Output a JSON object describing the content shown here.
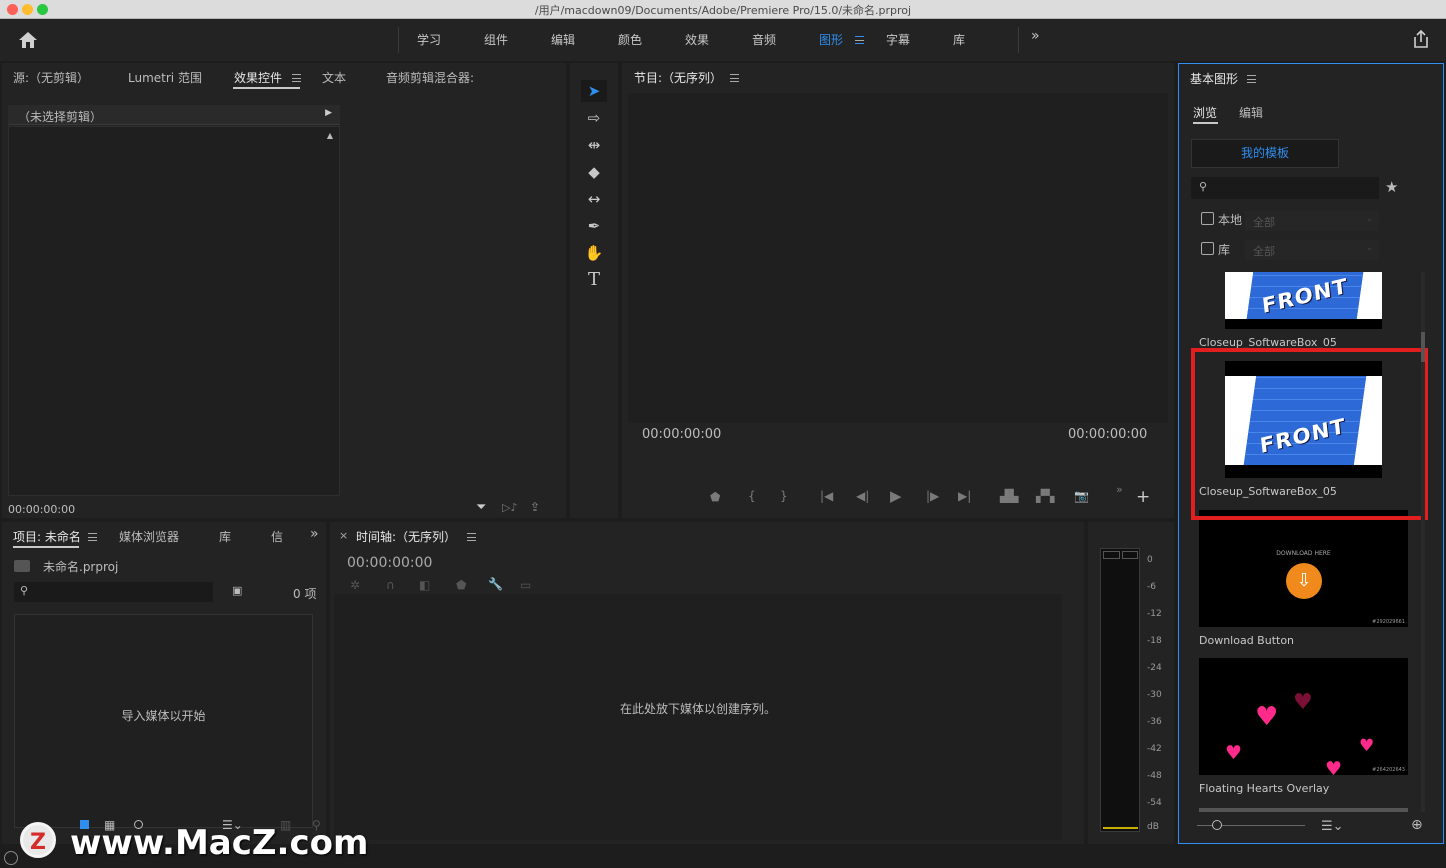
{
  "window": {
    "title": "/用户/macdown09/Documents/Adobe/Premiere Pro/15.0/未命名.prproj",
    "traffic_colors": [
      "#fe5f57",
      "#febc2e",
      "#28c840"
    ]
  },
  "workspaces": {
    "items": [
      "学习",
      "组件",
      "编辑",
      "颜色",
      "效果",
      "音频",
      "图形",
      "字幕",
      "库"
    ],
    "active": "图形",
    "accent": "#2f8ef0",
    "more": "»"
  },
  "source_panel": {
    "tabs": [
      "源:（无剪辑）",
      "Lumetri 范围",
      "效果控件",
      "文本",
      "音频剪辑混合器:"
    ],
    "active": "效果控件",
    "no_clip": "（未选择剪辑）",
    "timecode": "00:00:00:00"
  },
  "program_panel": {
    "title": "节目:（无序列）",
    "timecode_left": "00:00:00:00",
    "timecode_right": "00:00:00:00"
  },
  "project_panel": {
    "tabs": [
      "项目: 未命名",
      "媒体浏览器",
      "库",
      "信"
    ],
    "file": "未命名.prproj",
    "count": "0 项",
    "empty_text": "导入媒体以开始"
  },
  "timeline_panel": {
    "close": "×",
    "title": "时间轴:（无序列）",
    "timecode": "00:00:00:00",
    "empty_text": "在此处放下媒体以创建序列。"
  },
  "meter": {
    "scale": [
      "0",
      "-6",
      "-12",
      "-18",
      "-24",
      "-30",
      "-36",
      "-42",
      "-48",
      "-54",
      "dB"
    ]
  },
  "essential_graphics": {
    "title": "基本图形",
    "tabs": [
      "浏览",
      "编辑"
    ],
    "active_tab": "浏览",
    "my_templates": "我的模板",
    "filters": [
      {
        "label": "本地",
        "value": "全部"
      },
      {
        "label": "库",
        "value": "全部"
      }
    ],
    "templates": [
      {
        "name": "Closeup_SoftwareBox_05",
        "thumb_text": "FRONT"
      },
      {
        "name": "Closeup_SoftwareBox_05",
        "thumb_text": "FRONT",
        "highlighted": true
      },
      {
        "name": "Download Button",
        "thumb_text": "DOWNLOAD HERE",
        "id": "#292029661"
      },
      {
        "name": "Floating Hearts Overlay",
        "id": "#264202643"
      }
    ],
    "highlight_color": "#e31e1e"
  },
  "watermark": {
    "text": "www.MacZ.com",
    "logo": "Z"
  }
}
